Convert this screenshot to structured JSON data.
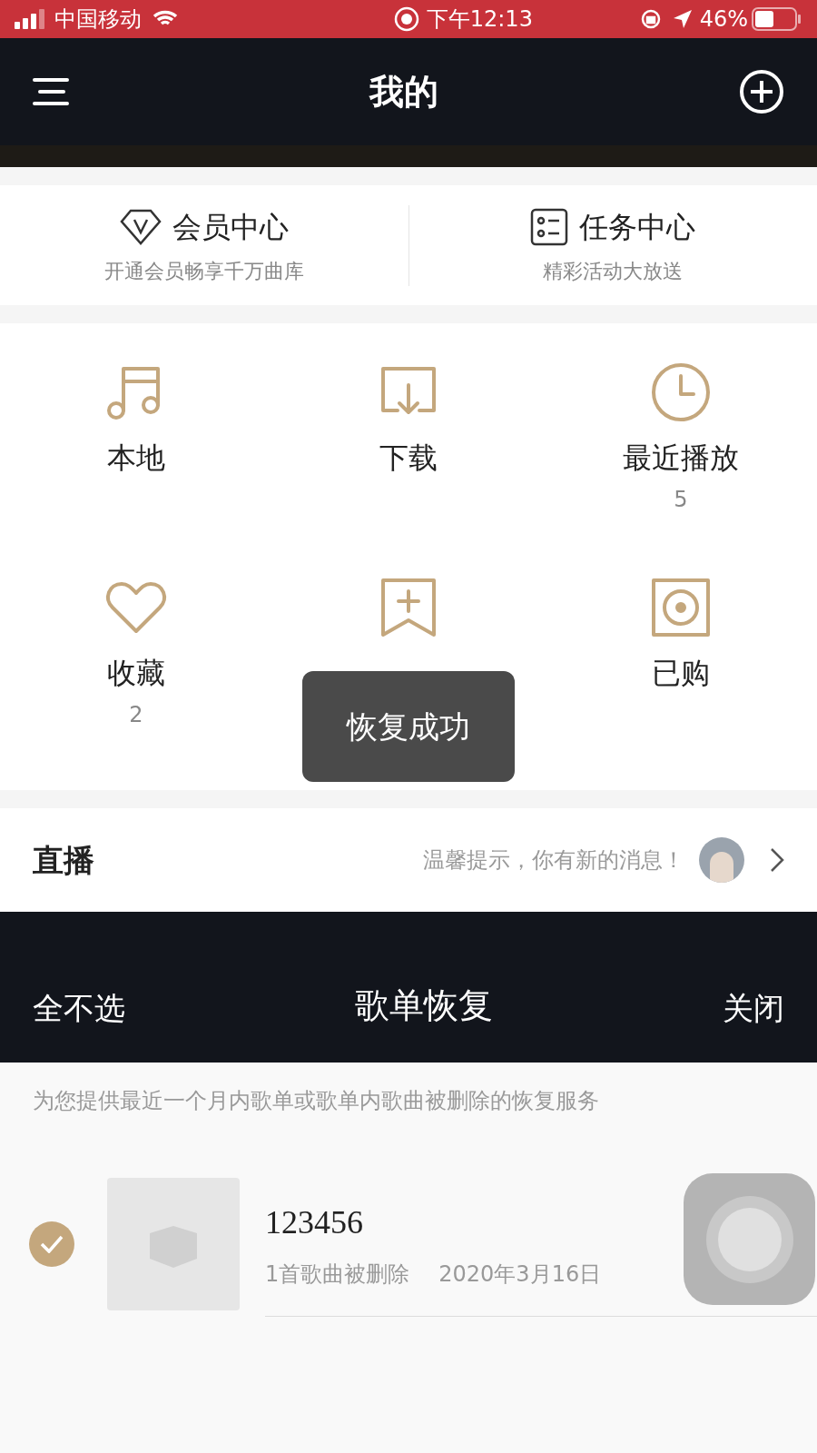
{
  "status_bar": {
    "carrier": "中国移动",
    "time": "下午12:13",
    "battery": "46%"
  },
  "nav": {
    "title": "我的"
  },
  "promos": [
    {
      "kind": "vip",
      "title": "会员中心",
      "subtitle": "开通会员畅享千万曲库"
    },
    {
      "kind": "task",
      "title": "任务中心",
      "subtitle": "精彩活动大放送"
    }
  ],
  "shortcuts": [
    {
      "kind": "music",
      "label": "本地"
    },
    {
      "kind": "download",
      "label": "下载"
    },
    {
      "kind": "clock",
      "label": "最近播放",
      "count": "5"
    },
    {
      "kind": "heart",
      "label": "收藏",
      "count": "2"
    },
    {
      "kind": "bookmark"
    },
    {
      "kind": "disc",
      "label": "已购"
    }
  ],
  "live": {
    "title": "直播",
    "message": "温馨提示，你有新的消息！"
  },
  "restore_sheet": {
    "left_action": "全不选",
    "title": "歌单恢复",
    "right_action": "关闭",
    "description": "为您提供最近一个月内歌单或歌单内歌曲被删除的恢复服务",
    "items": [
      {
        "name": "123456",
        "detail": "1首歌曲被删除",
        "date": "2020年3月16日",
        "selected": true
      }
    ]
  },
  "toast": "恢复成功"
}
